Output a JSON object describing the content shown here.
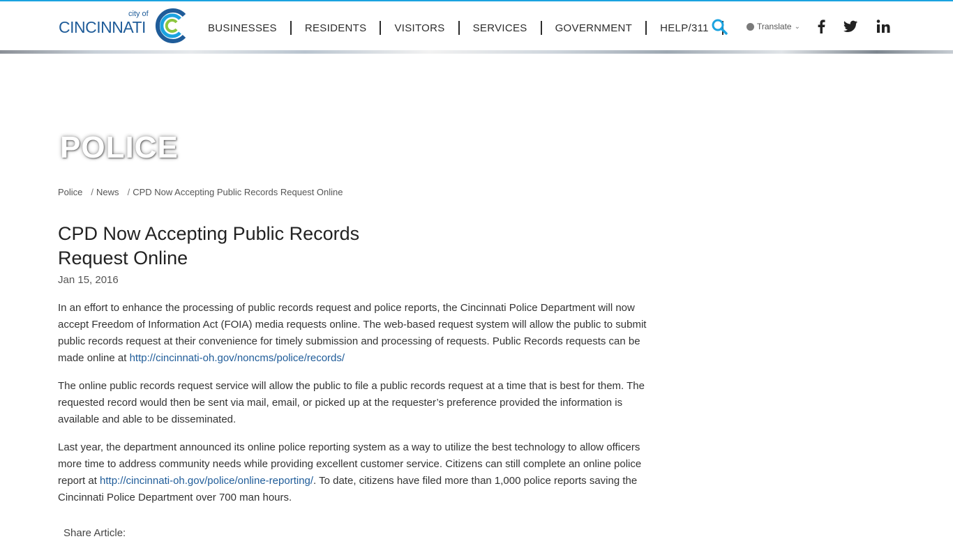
{
  "colors": {
    "accent": "#1ba3e0",
    "brand": "#1f5c99",
    "link": "#1f5c99"
  },
  "logo": {
    "small": "city of",
    "main": "CINCINNATI"
  },
  "nav": {
    "items": [
      "BUSINESSES",
      "RESIDENTS",
      "VISITORS",
      "SERVICES",
      "GOVERNMENT",
      "HELP/311"
    ],
    "search_icon": "search-icon",
    "translate_label": "Translate",
    "social": [
      "facebook-icon",
      "twitter-icon",
      "linkedin-icon"
    ]
  },
  "hero": {
    "title": "POLICE"
  },
  "breadcrumb": {
    "items": [
      "Police",
      "News",
      "CPD Now Accepting Public Records Request Online"
    ],
    "separator": "/"
  },
  "article": {
    "title": "CPD Now Accepting Public Records Request Online",
    "date": "Jan 15, 2016",
    "p1_text": "In an effort to enhance the processing of public records request and police reports, the Cincinnati Police Department will now accept Freedom of Information Act (FOIA) media requests online. The web-based request system will allow the public to submit public records request at their convenience for timely submission and processing of requests. Public Records requests can be made online at ",
    "p1_link": "http://cincinnati-oh.gov/noncms/police/records/",
    "p2_text": "The online public records request service will allow the public to file a public records request at a time that is best for them. The requested record would then be sent via mail, email, or picked up at the requester’s preference provided the information is available and able to be disseminated.",
    "p3_text_a": "Last year, the department announced its online police reporting system as a way to utilize the best technology to allow officers more time to address community needs while providing excellent customer service. Citizens can still complete an online police report at ",
    "p3_link": "http://cincinnati-oh.gov/police/online-reporting/",
    "p3_text_b": ". To date, citizens have filed more than 1,000 police reports saving the Cincinnati Police Department over 700 man hours.",
    "share_label": "Share Article:"
  }
}
